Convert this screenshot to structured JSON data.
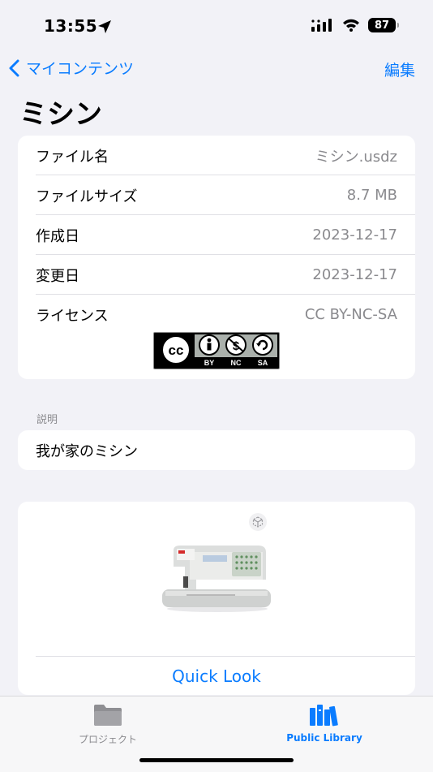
{
  "status": {
    "time": "13:55",
    "battery": "87"
  },
  "nav": {
    "back_label": "マイコンテンツ",
    "edit_label": "編集"
  },
  "title": "ミシン",
  "info_rows": [
    {
      "label": "ファイル名",
      "value": "ミシン.usdz"
    },
    {
      "label": "ファイルサイズ",
      "value": "8.7 MB"
    },
    {
      "label": "作成日",
      "value": "2023-12-17"
    },
    {
      "label": "変更日",
      "value": "2023-12-17"
    },
    {
      "label": "ライセンス",
      "value": "CC BY-NC-SA"
    }
  ],
  "license_badge": {
    "parts": [
      "BY",
      "NC",
      "SA"
    ]
  },
  "description": {
    "section_label": "説明",
    "text": "我が家のミシン"
  },
  "preview": {
    "quick_look_label": "Quick Look"
  },
  "tabs": [
    {
      "label": "プロジェクト",
      "icon": "folder-icon",
      "selected": false
    },
    {
      "label": "Public Library",
      "icon": "books-icon",
      "selected": true
    }
  ],
  "colors": {
    "accent": "#0a7cff",
    "background": "#f2f2f7",
    "secondary_text": "#8a8a8e"
  }
}
